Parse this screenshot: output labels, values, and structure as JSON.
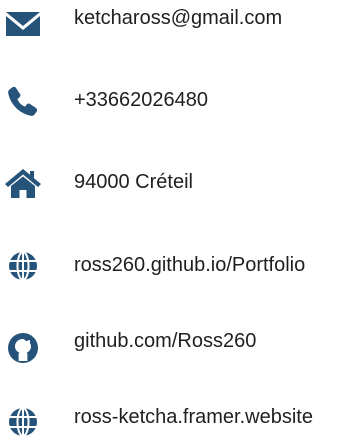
{
  "colors": {
    "icon": "#26537a",
    "text": "#1f1f1f",
    "background": "#ffffff"
  },
  "contacts": [
    {
      "icon": "envelope-icon",
      "text": "ketchaross@gmail.com"
    },
    {
      "icon": "phone-icon",
      "text": "+33662026480"
    },
    {
      "icon": "home-icon",
      "text": "94000 Créteil"
    },
    {
      "icon": "globe-icon",
      "text": "ross260.github.io/Portfolio"
    },
    {
      "icon": "github-icon",
      "text": "github.com/Ross260"
    },
    {
      "icon": "globe-icon",
      "text": "ross-ketcha.framer.website"
    }
  ]
}
